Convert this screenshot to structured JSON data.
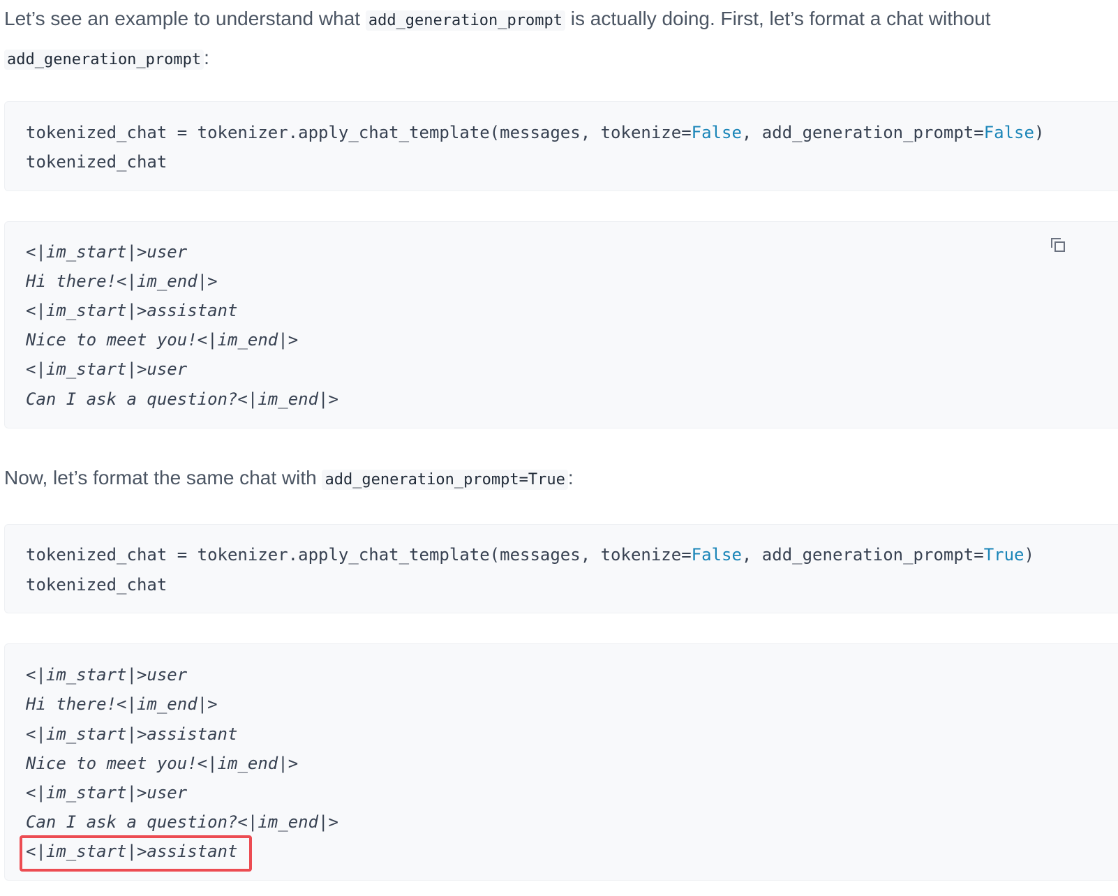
{
  "intro": {
    "text_before": "Let’s see an example to understand what ",
    "code1": "add_generation_prompt",
    "text_middle": " is actually doing. First, let’s format a chat without",
    "code2": "add_generation_prompt",
    "text_after": ":"
  },
  "code_block_1": {
    "line1": {
      "a": "tokenized_chat = tokenizer.apply_chat_template(messages, tokenize=",
      "kw1": "False",
      "b": ", add_generation_prompt=",
      "kw2": "False",
      "c": ")"
    },
    "line2": "tokenized_chat"
  },
  "output_block_1": {
    "lines": [
      {
        "a": "<|",
        "b": "im_start",
        "c": "|>user"
      },
      {
        "a": "Hi there!<|",
        "b": "im_end",
        "c": "|>"
      },
      {
        "a": "<|",
        "b": "im_start",
        "c": "|>assistant"
      },
      {
        "a": "Nice to meet you!<|",
        "b": "im_end",
        "c": "|>"
      },
      {
        "a": "<|",
        "b": "im_start",
        "c": "|>user"
      },
      {
        "a": "Can I ask a question?<|",
        "b": "im_end",
        "c": "|>"
      }
    ]
  },
  "middle": {
    "text_before": "Now, let’s format the same chat with ",
    "code": "add_generation_prompt=True",
    "text_after": ":"
  },
  "code_block_2": {
    "line1": {
      "a": "tokenized_chat = tokenizer.apply_chat_template(messages, tokenize=",
      "kw1": "False",
      "b": ", add_generation_prompt=",
      "kw2": "True",
      "c": ")"
    },
    "line2": "tokenized_chat"
  },
  "output_block_2": {
    "lines": [
      {
        "a": "<|",
        "b": "im_start",
        "c": "|>user"
      },
      {
        "a": "Hi there!<|",
        "b": "im_end",
        "c": "|>"
      },
      {
        "a": "<|",
        "b": "im_start",
        "c": "|>assistant"
      },
      {
        "a": "Nice to meet you!<|",
        "b": "im_end",
        "c": "|>"
      },
      {
        "a": "<|",
        "b": "im_start",
        "c": "|>user"
      },
      {
        "a": "Can I ask a question?<|",
        "b": "im_end",
        "c": "|>"
      },
      {
        "a": "<|",
        "b": "im_start",
        "c": "|>assistant"
      }
    ]
  },
  "colors": {
    "keyword": "#1a85b8",
    "highlight": "#ec4c52",
    "code_bg": "#f8f9fb",
    "text": "#4b5563"
  },
  "icons": {
    "copy": "copy-icon"
  }
}
